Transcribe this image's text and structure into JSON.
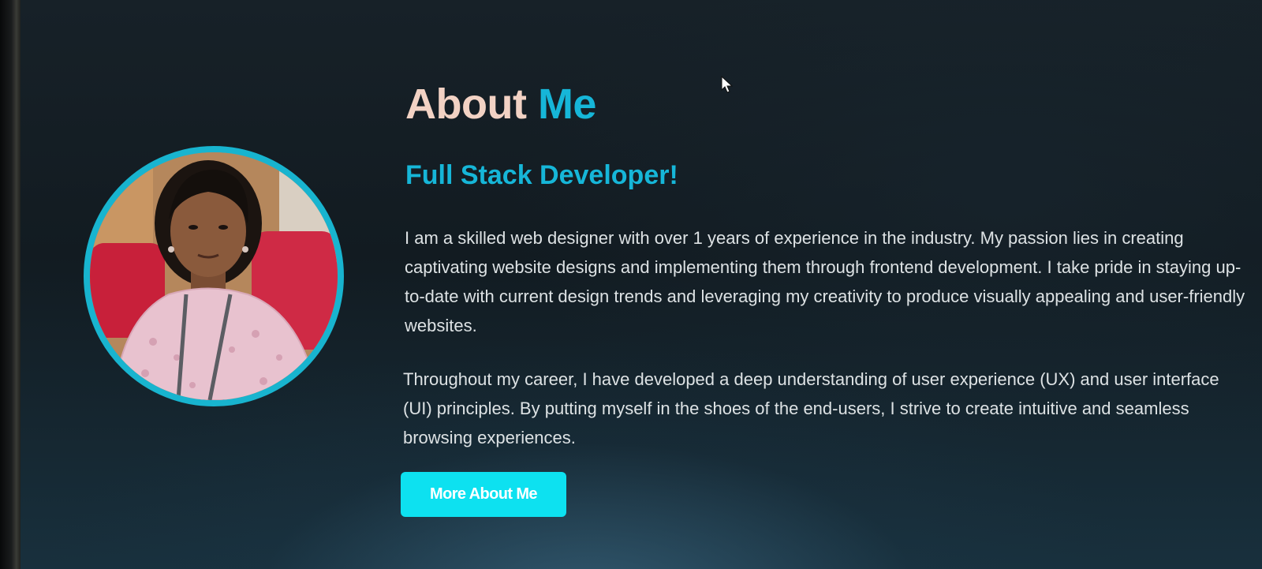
{
  "about": {
    "heading_part1": "About",
    "heading_part2": "Me",
    "subtitle": "Full Stack Developer!",
    "paragraphs": [
      "I am a skilled web designer with over 1 years of experience in the industry. My passion lies in creating captivating website designs and implementing them through frontend development. I take pride in staying up-to-date with current design trends and leveraging my creativity to produce visually appealing and user-friendly websites.",
      "Throughout my career, I have developed a deep understanding of user experience (UX) and user interface (UI) principles. By putting myself in the shoes of the end-users, I strive to create intuitive and seamless browsing experiences."
    ],
    "button_label": "More About Me"
  },
  "profile_photo": {
    "icon": "profile-photo",
    "ring_color": "#18b4cf"
  },
  "theme": {
    "accent": "#16b6d8",
    "button_bg": "#0de1f0",
    "heading_color": "#f2d2c4",
    "text_color": "#dde2e4"
  }
}
